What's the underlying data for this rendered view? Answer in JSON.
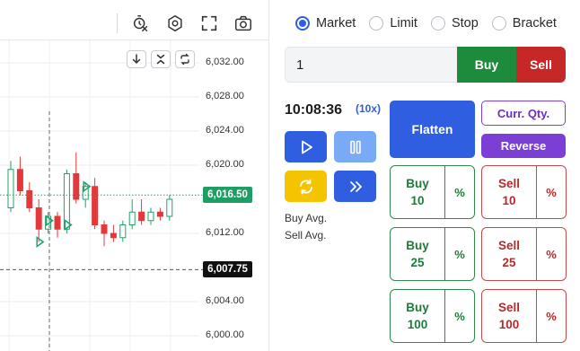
{
  "chart": {
    "toolbar_icons": [
      "crosshair-time-icon",
      "hexagon-settings-icon",
      "fullscreen-icon",
      "camera-icon"
    ],
    "mini_buttons": [
      "arrow-down-icon",
      "collapse-icon",
      "swap-icon"
    ],
    "price_labels": [
      "6,032.00",
      "6,028.00",
      "6,024.00",
      "6,020.00",
      "6,012.00",
      "6,004.00",
      "6,000.00"
    ],
    "last_price": "6,016.50",
    "crosshair_price": "6,007.75",
    "colors": {
      "up": "#1ea36a",
      "down": "#e5383b",
      "last_price_bg": "#1e9e64",
      "crosshair_bg": "#111111"
    },
    "candles": [
      {
        "o": 6015.0,
        "h": 6020.5,
        "l": 6014.5,
        "c": 6019.5
      },
      {
        "o": 6019.5,
        "h": 6021.0,
        "l": 6016.5,
        "c": 6017.0
      },
      {
        "o": 6017.0,
        "h": 6018.0,
        "l": 6014.5,
        "c": 6015.0
      },
      {
        "o": 6015.0,
        "h": 6016.0,
        "l": 6011.0,
        "c": 6012.5
      },
      {
        "o": 6012.5,
        "h": 6014.5,
        "l": 6012.0,
        "c": 6014.0
      },
      {
        "o": 6014.0,
        "h": 6014.5,
        "l": 6011.5,
        "c": 6012.5
      },
      {
        "o": 6012.5,
        "h": 6019.5,
        "l": 6012.0,
        "c": 6019.0
      },
      {
        "o": 6019.0,
        "h": 6021.5,
        "l": 6015.5,
        "c": 6016.0
      },
      {
        "o": 6016.0,
        "h": 6018.0,
        "l": 6015.0,
        "c": 6017.5
      },
      {
        "o": 6017.5,
        "h": 6018.5,
        "l": 6012.5,
        "c": 6013.0
      },
      {
        "o": 6013.0,
        "h": 6013.5,
        "l": 6010.5,
        "c": 6012.0
      },
      {
        "o": 6012.0,
        "h": 6013.0,
        "l": 6011.0,
        "c": 6011.5
      },
      {
        "o": 6011.5,
        "h": 6013.5,
        "l": 6011.0,
        "c": 6013.0
      },
      {
        "o": 6013.0,
        "h": 6016.0,
        "l": 6012.5,
        "c": 6014.5
      },
      {
        "o": 6014.5,
        "h": 6016.0,
        "l": 6013.0,
        "c": 6013.5
      },
      {
        "o": 6013.5,
        "h": 6015.0,
        "l": 6013.0,
        "c": 6014.5
      },
      {
        "o": 6014.5,
        "h": 6015.0,
        "l": 6013.5,
        "c": 6014.0
      },
      {
        "o": 6014.0,
        "h": 6016.5,
        "l": 6013.5,
        "c": 6016.0
      }
    ],
    "markers": [
      {
        "candle": 4,
        "price": 6013.5,
        "kind": "buy"
      },
      {
        "candle": 6,
        "price": 6013.0,
        "kind": "buy"
      },
      {
        "candle": 8,
        "price": 6017.5,
        "kind": "buy"
      },
      {
        "candle": 3,
        "price": 6011.0,
        "kind": "buy"
      }
    ]
  },
  "panel": {
    "order_types": [
      {
        "label": "Market",
        "selected": true
      },
      {
        "label": "Limit",
        "selected": false
      },
      {
        "label": "Stop",
        "selected": false
      },
      {
        "label": "Bracket",
        "selected": false
      }
    ],
    "quantity": "1",
    "buy_label": "Buy",
    "sell_label": "Sell",
    "time": "10:08:36",
    "multiplier": "(10x)",
    "flatten_label": "Flatten",
    "curr_qty_label": "Curr. Qty.",
    "reverse_label": "Reverse",
    "buy_avg_label": "Buy Avg.",
    "sell_avg_label": "Sell Avg.",
    "control_icons": [
      "play-icon",
      "pause-icon",
      "refresh-icon",
      "fast-forward-icon"
    ],
    "quick_buys": [
      {
        "action": "Buy",
        "qty": "10",
        "pct": "%"
      },
      {
        "action": "Buy",
        "qty": "25",
        "pct": "%"
      },
      {
        "action": "Buy",
        "qty": "100",
        "pct": "%"
      }
    ],
    "quick_sells": [
      {
        "action": "Sell",
        "qty": "10",
        "pct": "%"
      },
      {
        "action": "Sell",
        "qty": "25",
        "pct": "%"
      },
      {
        "action": "Sell",
        "qty": "100",
        "pct": "%"
      }
    ],
    "colors": {
      "buy": "#1e8a3c",
      "sell": "#c62828",
      "primary": "#2f5fe0",
      "purple": "#7b3fd6",
      "amber": "#f5c400"
    }
  }
}
